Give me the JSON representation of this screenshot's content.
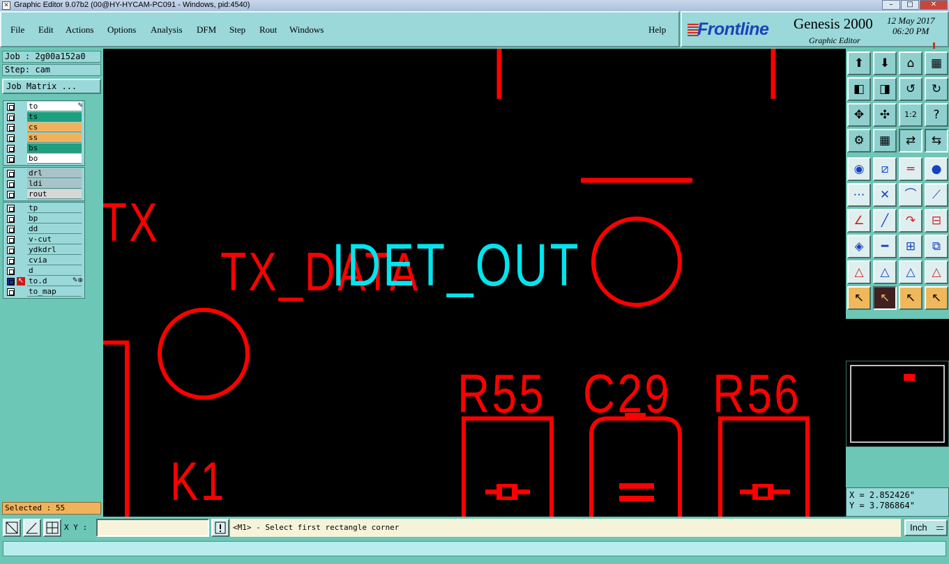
{
  "window": {
    "title": "Graphic Editor 9.07b2 (00@HY-HYCAM-PC091 - Windows, pid:4540)",
    "buttons": [
      "minimize",
      "maximize",
      "close"
    ]
  },
  "menu": {
    "items": [
      "File",
      "Edit",
      "Actions",
      "Options",
      "Analysis",
      "DFM",
      "Step",
      "Rout",
      "Windows"
    ],
    "help": "Help"
  },
  "logo": {
    "brand": "Frontline",
    "product": "Genesis 2000",
    "subtitle": "Graphic Editor",
    "date": "12 May 2017",
    "time": "06:20 PM"
  },
  "job": {
    "job_label": "Job : 2g00a152a0",
    "step_label": "Step: cam",
    "matrix_button": "Job Matrix ..."
  },
  "layers": {
    "group1": [
      {
        "name": "to",
        "color": "#ffffff"
      },
      {
        "name": "ts",
        "color": "#1e9f7f"
      },
      {
        "name": "cs",
        "color": "#f2b25b"
      },
      {
        "name": "ss",
        "color": "#f2b25b"
      },
      {
        "name": "bs",
        "color": "#1e9f7f"
      },
      {
        "name": "bo",
        "color": "#ffffff"
      }
    ],
    "group2": [
      {
        "name": "drl",
        "color": "#a9c3c8"
      },
      {
        "name": "ldi",
        "color": "#a9c3c8"
      },
      {
        "name": "rout",
        "color": "#d7d7d7"
      }
    ],
    "group3": [
      {
        "name": "tp"
      },
      {
        "name": "bp"
      },
      {
        "name": "dd"
      },
      {
        "name": "v-cut"
      },
      {
        "name": "ydkdrl"
      },
      {
        "name": "cvia"
      },
      {
        "name": "d"
      },
      {
        "name": "to.d"
      },
      {
        "name": "to_map"
      }
    ]
  },
  "selected_text": "Selected : 55",
  "canvas": {
    "labels": [
      "TX",
      "TX_DATA",
      "IDET_OUT",
      "K1",
      "R55",
      "C29",
      "R56"
    ],
    "feature_color": "#ff0000",
    "highlight_color": "#00e5ee"
  },
  "coords": {
    "x": "X = 2.852426\"",
    "y": "Y = 3.786864\""
  },
  "command": {
    "xy_label": "X Y :",
    "xy_value": "",
    "prompt": "<M1> - Select first rectangle corner",
    "units": "Inch"
  },
  "toolbar_icons": [
    "zoom-home-icon",
    "zoom-fit-icon",
    "home-icon",
    "grid-view-icon",
    "pan-left-icon",
    "pan-right-icon",
    "undo-view-icon",
    "redo-view-icon",
    "zoom-in-icon",
    "zoom-out-icon",
    "scale-1-2-icon",
    "help-icon",
    "snap-icon",
    "grid-icon",
    "net-highlight-icon",
    "net-select-icon",
    "pad-select-icon",
    "line-add-icon",
    "measure-icon",
    "point-icon",
    "connect-icon",
    "cross-icon",
    "arc-icon",
    "line-point-icon",
    "angle-icon",
    "slash-icon",
    "rotate-icon",
    "mirror-icon",
    "move-pad-icon",
    "line-cut-icon",
    "fit-icon",
    "squares-icon",
    "triangle-a-icon",
    "triangle-b-icon",
    "triangle-c-icon",
    "triangle-d-icon",
    "pointer-icon",
    "pointer-select-icon",
    "pointer-rect-icon",
    "pointer-route-icon"
  ]
}
